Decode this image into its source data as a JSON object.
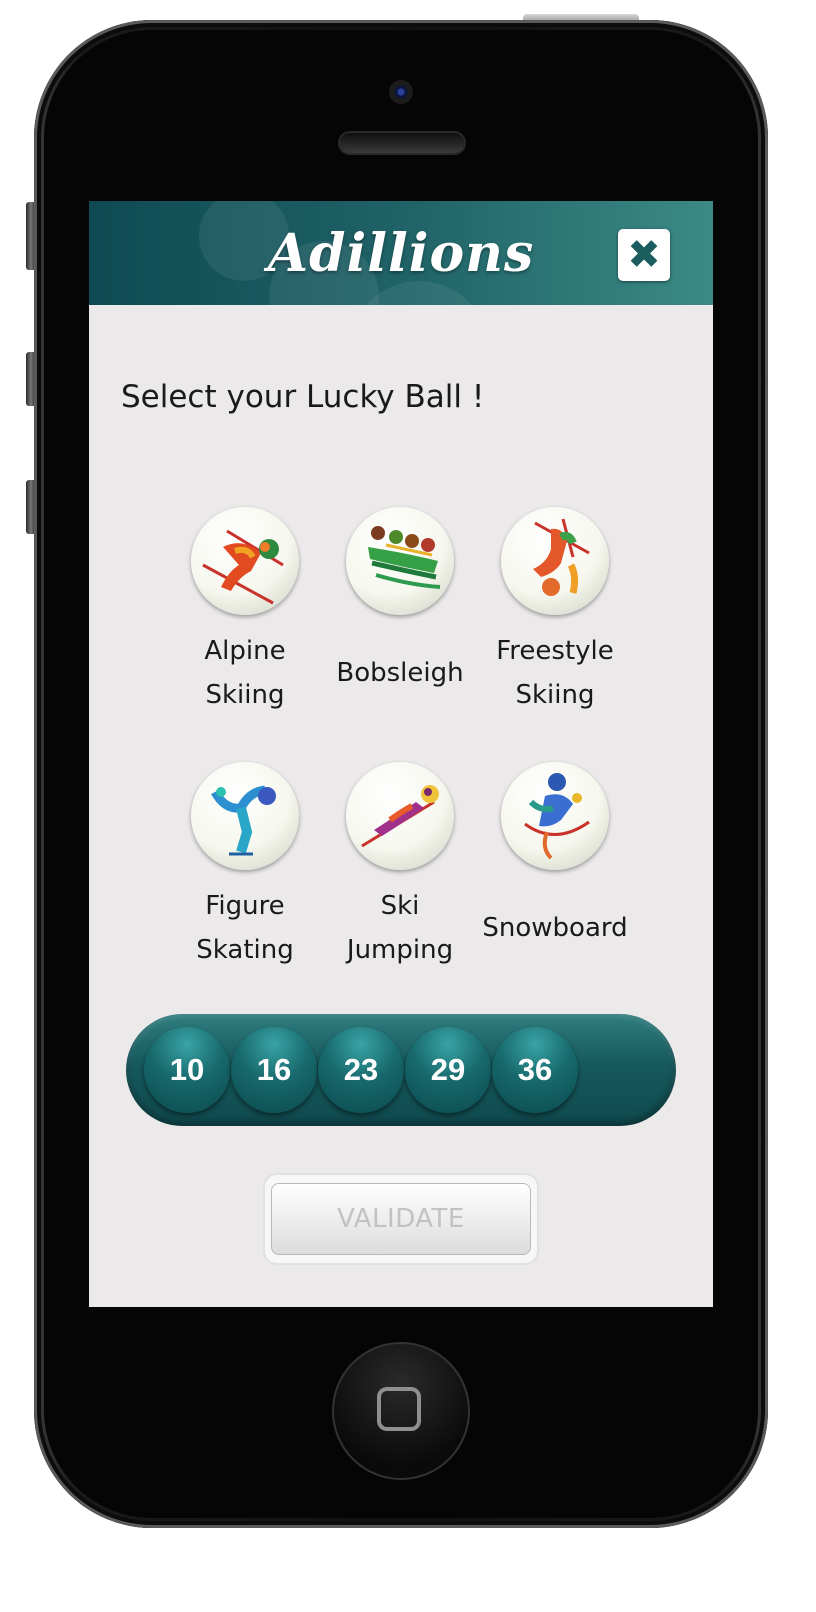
{
  "header": {
    "app_title": "Adillions",
    "close_icon": "close-x-icon"
  },
  "prompt": "Select your Lucky Ball !",
  "sports": [
    {
      "name": "Alpine\nSkiing",
      "icon": "alpine-skiing-icon"
    },
    {
      "name": "Bobsleigh",
      "icon": "bobsleigh-icon"
    },
    {
      "name": "Freestyle\nSkiing",
      "icon": "freestyle-skiing-icon"
    },
    {
      "name": "Figure\nSkating",
      "icon": "figure-skating-icon"
    },
    {
      "name": "Ski\nJumping",
      "icon": "ski-jumping-icon"
    },
    {
      "name": "Snowboard",
      "icon": "snowboard-icon"
    }
  ],
  "selected_numbers": [
    "10",
    "16",
    "23",
    "29",
    "36"
  ],
  "validate_label": "VALIDATE",
  "colors": {
    "header": "#1f6267",
    "accent": "#17595d",
    "screen_bg": "#ece9ea"
  }
}
